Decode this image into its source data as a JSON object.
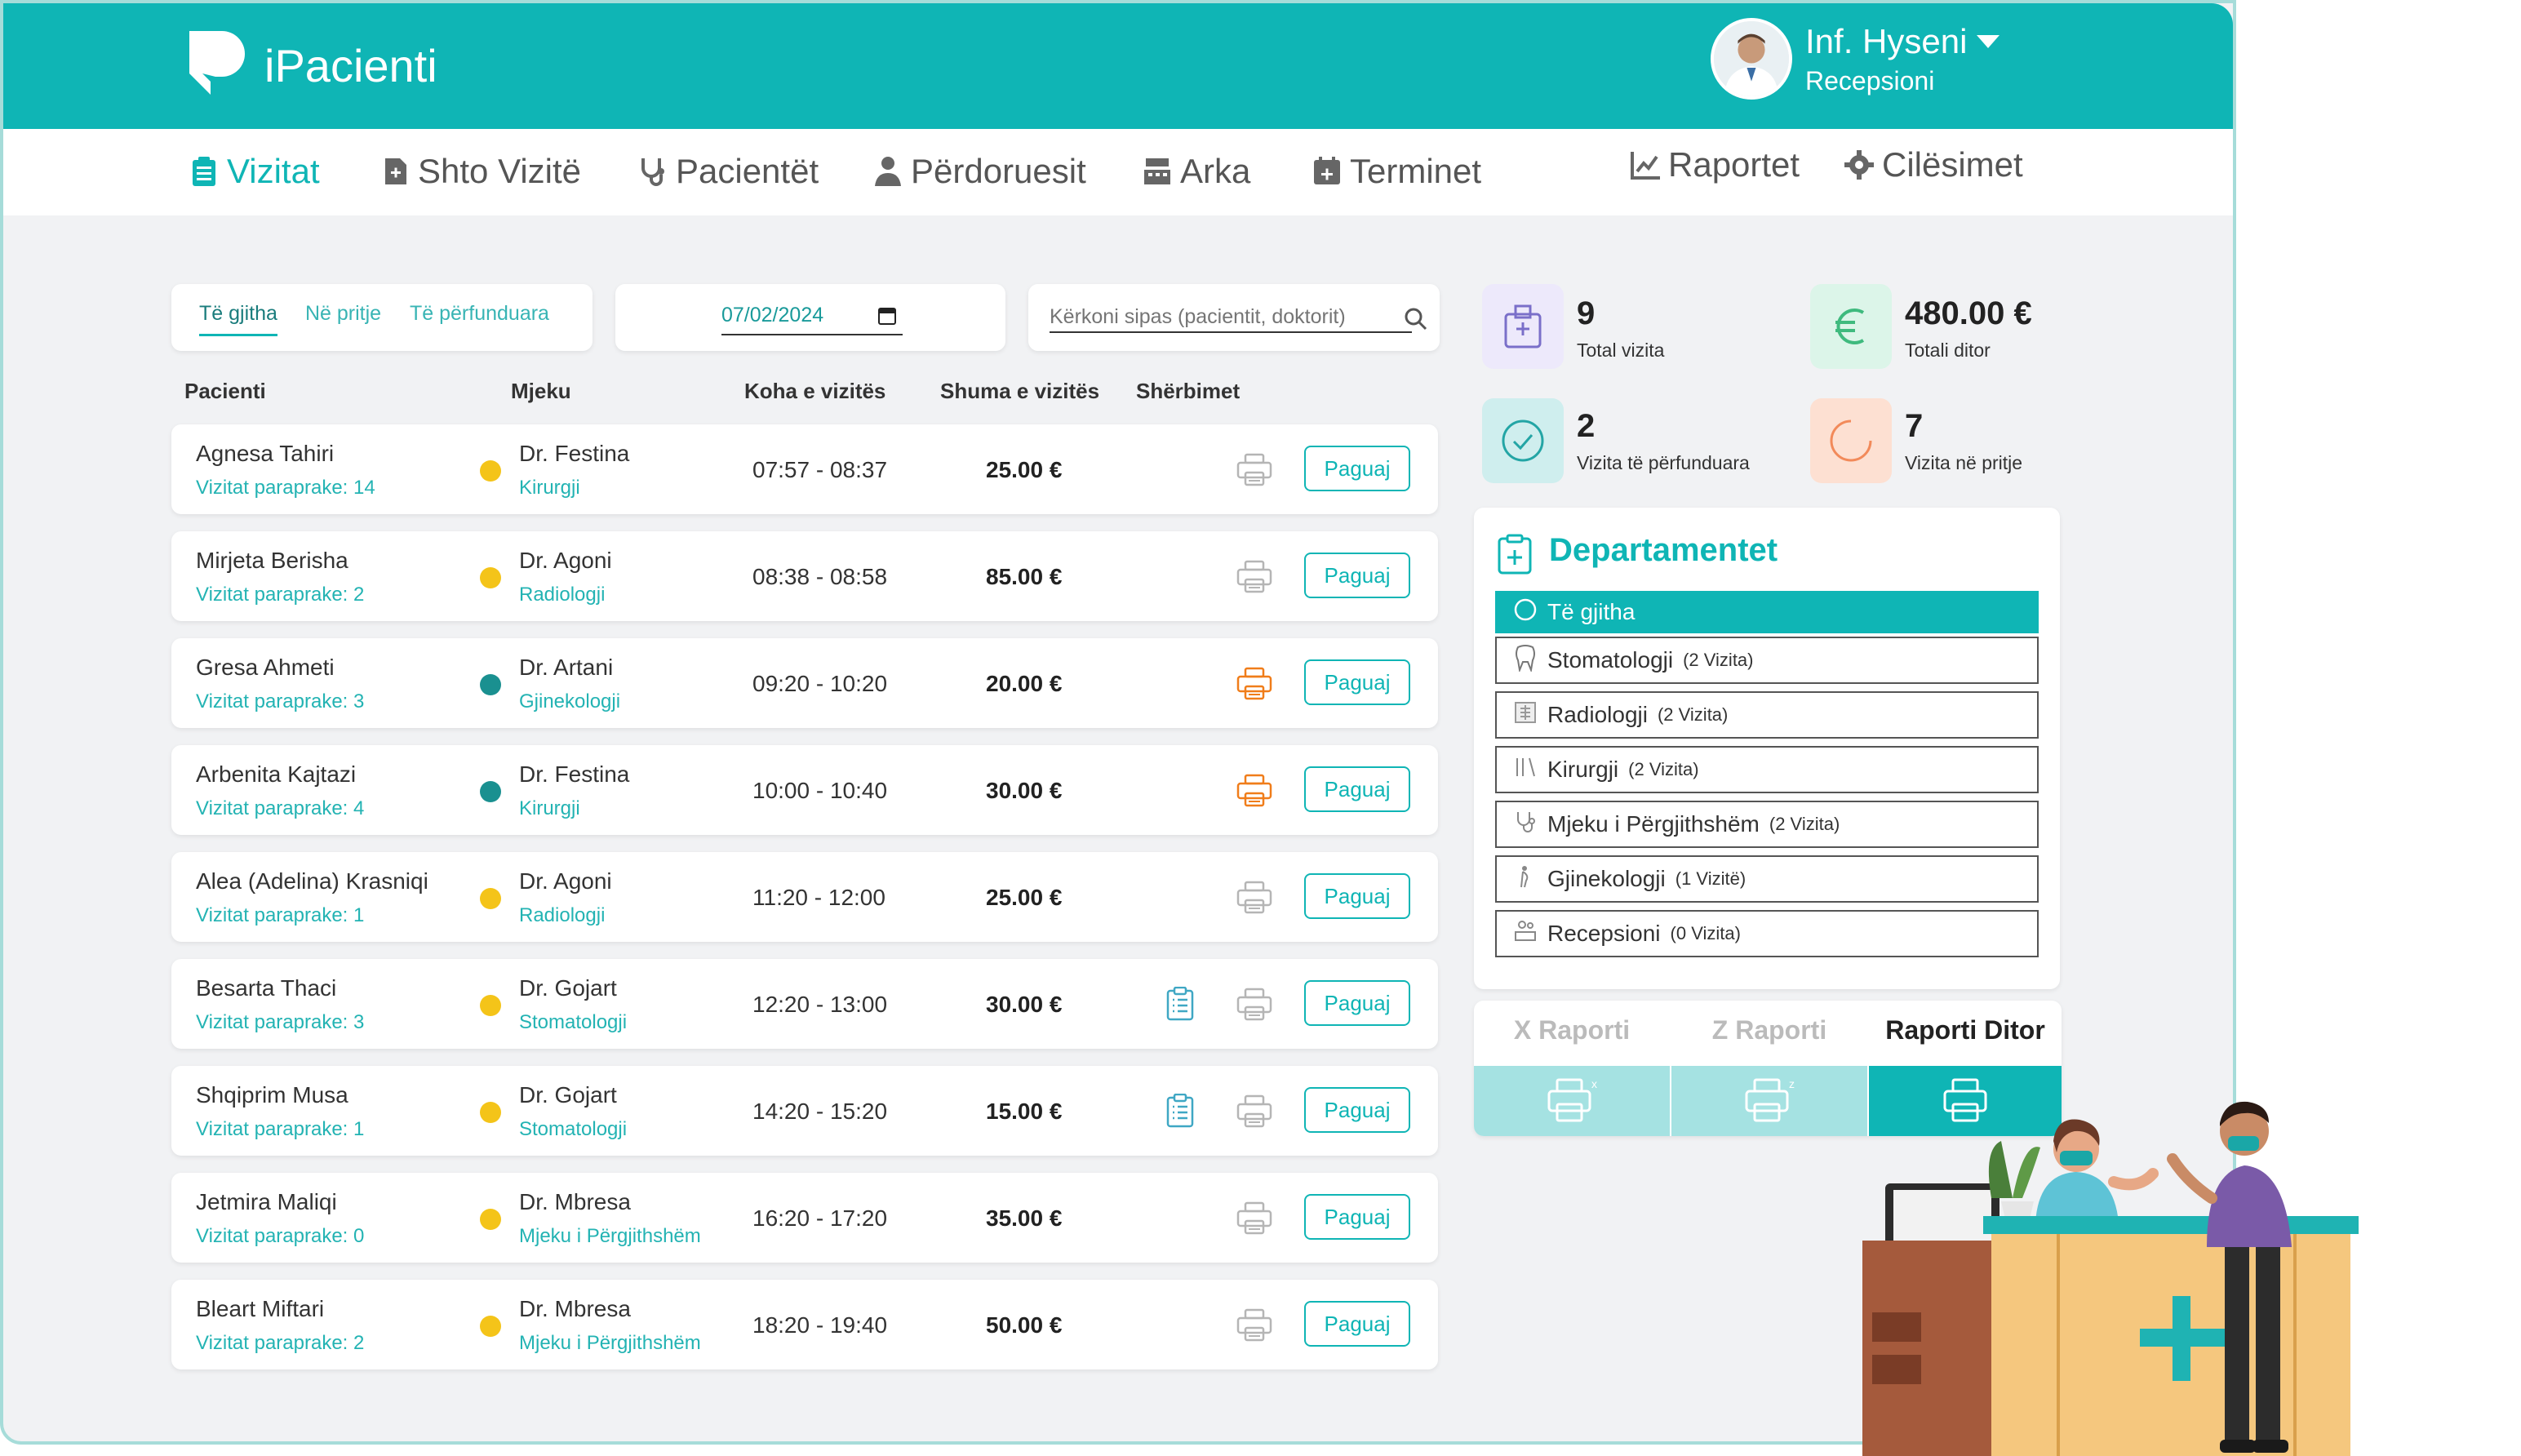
{
  "app": {
    "name": "iPacienti"
  },
  "user": {
    "name": "Inf. Hyseni",
    "role": "Recepsioni"
  },
  "nav": {
    "vizitat": "Vizitat",
    "shto_vizite": "Shto Vizitë",
    "pacientet": "Pacientët",
    "perdoruesit": "Përdoruesit",
    "arka": "Arka",
    "terminet": "Terminet",
    "raportet": "Raportet",
    "cilesimet": "Cilësimet"
  },
  "filters": {
    "tabs": [
      "Të gjitha",
      "Në pritje",
      "Të përfunduara"
    ],
    "date": "07/02/2024",
    "search_placeholder": "Kërkoni sipas (pacientit, doktorit)"
  },
  "table": {
    "headers": [
      "Pacienti",
      "Mjeku",
      "Koha e vizitës",
      "Shuma e vizitës",
      "Shërbimet"
    ],
    "pay_label": "Paguaj",
    "rows": [
      {
        "patient": "Agnesa Tahiri",
        "previous": "Vizitat paraprake: 14",
        "status_color": "#f4c419",
        "doctor": "Dr. Festina",
        "department": "Kirurgji",
        "time": "07:57 - 08:37",
        "amount": "25.00 €",
        "has_service": false,
        "print_active": false
      },
      {
        "patient": "Mirjeta Berisha",
        "previous": "Vizitat paraprake: 2",
        "status_color": "#f4c419",
        "doctor": "Dr. Agoni",
        "department": "Radiologji",
        "time": "08:38 - 08:58",
        "amount": "85.00 €",
        "has_service": false,
        "print_active": false
      },
      {
        "patient": "Gresa Ahmeti",
        "previous": "Vizitat paraprake: 3",
        "status_color": "#1a9090",
        "doctor": "Dr. Artani",
        "department": "Gjinekologji",
        "time": "09:20 - 10:20",
        "amount": "20.00 €",
        "has_service": false,
        "print_active": true
      },
      {
        "patient": "Arbenita Kajtazi",
        "previous": "Vizitat paraprake: 4",
        "status_color": "#1a9090",
        "doctor": "Dr. Festina",
        "department": "Kirurgji",
        "time": "10:00 - 10:40",
        "amount": "30.00 €",
        "has_service": false,
        "print_active": true
      },
      {
        "patient": "Alea (Adelina) Krasniqi",
        "previous": "Vizitat paraprake: 1",
        "status_color": "#f4c419",
        "doctor": "Dr. Agoni",
        "department": "Radiologji",
        "time": "11:20 - 12:00",
        "amount": "25.00 €",
        "has_service": false,
        "print_active": false
      },
      {
        "patient": "Besarta Thaci",
        "previous": "Vizitat paraprake: 3",
        "status_color": "#f4c419",
        "doctor": "Dr. Gojart",
        "department": "Stomatologji",
        "time": "12:20 - 13:00",
        "amount": "30.00 €",
        "has_service": true,
        "print_active": false
      },
      {
        "patient": "Shqiprim Musa",
        "previous": "Vizitat paraprake: 1",
        "status_color": "#f4c419",
        "doctor": "Dr. Gojart",
        "department": "Stomatologji",
        "time": "14:20 - 15:20",
        "amount": "15.00 €",
        "has_service": true,
        "print_active": false
      },
      {
        "patient": "Jetmira Maliqi",
        "previous": "Vizitat paraprake: 0",
        "status_color": "#f4c419",
        "doctor": "Dr. Mbresa",
        "department": "Mjeku i Përgjithshëm",
        "time": "16:20 - 17:20",
        "amount": "35.00 €",
        "has_service": false,
        "print_active": false
      },
      {
        "patient": "Bleart Miftari",
        "previous": "Vizitat paraprake: 2",
        "status_color": "#f4c419",
        "doctor": "Dr. Mbresa",
        "department": "Mjeku i Përgjithshëm",
        "time": "18:20 - 19:40",
        "amount": "50.00 €",
        "has_service": false,
        "print_active": false
      }
    ]
  },
  "stats": {
    "total_visits": {
      "value": "9",
      "label": "Total vizita"
    },
    "total_daily": {
      "value": "480.00 €",
      "label": "Totali ditor"
    },
    "completed": {
      "value": "2",
      "label": "Vizita të përfunduara"
    },
    "pending": {
      "value": "7",
      "label": "Vizita në pritje"
    }
  },
  "departments": {
    "title": "Departamentet",
    "items": [
      {
        "name": "Të gjitha",
        "count": "",
        "icon": "circle-icon",
        "active": true
      },
      {
        "name": "Stomatologji",
        "count": "(2 Vizita)",
        "icon": "tooth-icon",
        "active": false
      },
      {
        "name": "Radiologji",
        "count": "(2 Vizita)",
        "icon": "xray-icon",
        "active": false
      },
      {
        "name": "Kirurgji",
        "count": "(2 Vizita)",
        "icon": "scalpel-icon",
        "active": false
      },
      {
        "name": "Mjeku i Përgjithshëm",
        "count": "(2 Vizita)",
        "icon": "stethoscope-icon",
        "active": false
      },
      {
        "name": "Gjinekologji",
        "count": "(1 Vizitë)",
        "icon": "pregnant-icon",
        "active": false
      },
      {
        "name": "Recepsioni",
        "count": "(0 Vizita)",
        "icon": "reception-icon",
        "active": false
      }
    ]
  },
  "reports": {
    "x": "X Raporti",
    "z": "Z Raporti",
    "daily": "Raporti Ditor"
  },
  "colors": {
    "brand": "#0fb5b5",
    "pending": "#f4c419",
    "completed": "#1a9090",
    "print_highlight": "#f07d1a"
  }
}
